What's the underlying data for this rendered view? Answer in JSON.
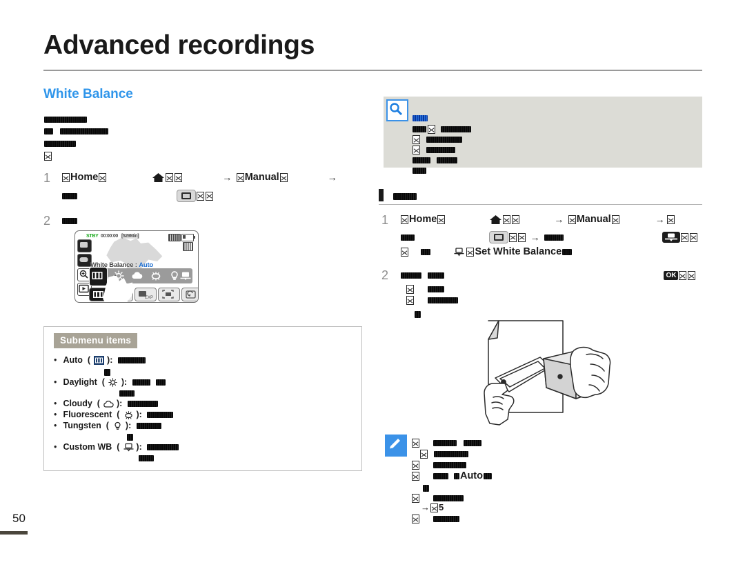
{
  "document": {
    "chapter_title": "Advanced recordings",
    "section_title": "White Balance",
    "page_number": "50"
  },
  "left_column": {
    "intro_lines": [
      {
        "type": "redacted",
        "width": 62
      },
      {
        "type": "redacted_pair",
        "widths": [
          14,
          70
        ]
      },
      {
        "type": "redacted",
        "width": 48
      },
      {
        "type": "xbox"
      }
    ],
    "step1": {
      "number": "1",
      "keyword_home": "Home",
      "keyword_manual": "Manual",
      "arrow": "→"
    },
    "step2": {
      "number": "2"
    },
    "lcd": {
      "status": "STBY",
      "timecode": "00:00:00",
      "remaining": "[529Min]",
      "title_label": "White Balance :",
      "title_value": "Auto",
      "options": [
        "wb-auto-icon",
        "daylight-icon",
        "cloudy-icon",
        "fluorescent-icon",
        "tungsten-icon",
        "custom-wb-icon"
      ],
      "bottom_buttons": [
        "wb-button",
        "exposure-button",
        "focus-button",
        "return-button"
      ],
      "left_buttons": [
        "record-button",
        "photo-button",
        "zoom-icon",
        "playback-icon"
      ],
      "indicators": [
        "battery-icon",
        "memory-card-icon"
      ]
    },
    "submenu": {
      "heading": "Submenu items",
      "items": [
        {
          "label": "Auto",
          "icon": "wb-auto-icon",
          "sep": "):",
          "desc_widths": [
            40
          ],
          "cont_widths": [
            9
          ]
        },
        {
          "label": "Daylight",
          "icon": "daylight-icon",
          "sep": "):",
          "desc_widths": [
            26,
            14
          ],
          "cont_widths": [
            22
          ]
        },
        {
          "label": "Cloudy",
          "icon": "cloudy-icon",
          "sep": "):",
          "desc_widths": [
            44
          ],
          "cont_widths": []
        },
        {
          "label": "Fluorescent",
          "icon": "fluorescent-icon",
          "sep": "):",
          "desc_widths": [
            38
          ],
          "cont_widths": []
        },
        {
          "label": "Tungsten",
          "icon": "tungsten-icon",
          "sep": "):",
          "desc_widths": [
            36
          ],
          "cont_widths": [
            9
          ]
        },
        {
          "label": "Custom WB",
          "icon": "custom-wb-icon",
          "sep": "):",
          "desc_widths": [
            46
          ],
          "cont_widths": [
            22
          ]
        }
      ]
    }
  },
  "right_column": {
    "info_box": {
      "icon": "magnifier-icon",
      "title_redacted_width": 22,
      "lines": [
        {
          "widths": [
            22,
            0,
            44
          ]
        },
        {
          "widths": [
            0,
            52
          ]
        },
        {
          "widths": [
            0,
            42
          ]
        },
        {
          "widths": [
            26,
            30
          ]
        },
        {
          "widths": [
            20
          ]
        }
      ]
    },
    "section_heading": {
      "bar": true,
      "redacted_width": 34
    },
    "step1": {
      "number": "1",
      "keyword_home": "Home",
      "keyword_manual": "Manual",
      "keyword_set_wb": "Set White Balance",
      "arrow": "→"
    },
    "step2": {
      "number": "2",
      "ok_label": "OK"
    },
    "illustration": "hands-holding-camcorder-at-white-paper",
    "note_box": {
      "icon": "note-pen-icon",
      "lines": [
        {
          "widths": [
            34,
            26
          ]
        },
        {
          "widths": [
            50
          ]
        },
        {
          "widths": [
            48
          ]
        },
        {
          "widths": [
            22
          ]
        },
        {
          "widths": [
            9
          ]
        },
        {
          "widths": [
            44
          ]
        },
        {
          "widths": [
            20
          ]
        }
      ],
      "keyword_auto": "Auto",
      "ref_arrow": "→",
      "ref_page": "5"
    }
  },
  "colors": {
    "accent_blue": "#2f95ea",
    "info_box_bg": "#dcdcd6",
    "submenu_tag_bg": "#a8a396",
    "status_green": "#17a81a",
    "page_bar": "#4a463c"
  }
}
